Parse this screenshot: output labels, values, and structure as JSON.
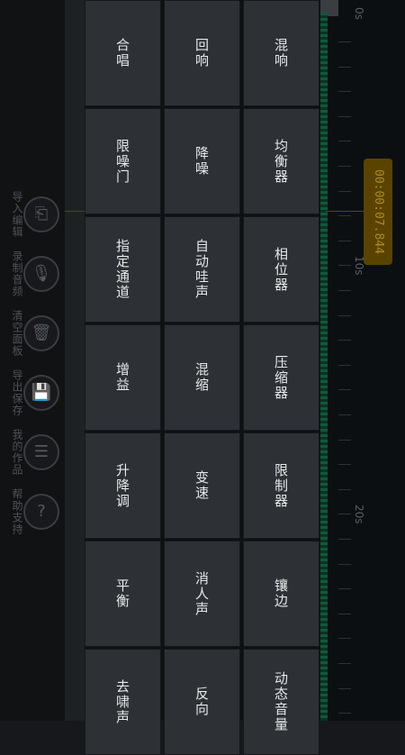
{
  "toolbar": {
    "tools": [
      {
        "label": "导入编辑",
        "icon": "import-icon",
        "glyph": "⎗"
      },
      {
        "label": "录制音频",
        "icon": "microphone-icon",
        "glyph": "🎙"
      },
      {
        "label": "清空面板",
        "icon": "trash-icon",
        "glyph": "🗑"
      },
      {
        "label": "导出保存",
        "icon": "save-icon",
        "glyph": "💾"
      },
      {
        "label": "我的作品",
        "icon": "list-icon",
        "glyph": "☰"
      },
      {
        "label": "帮助支持",
        "icon": "help-icon",
        "glyph": "?"
      }
    ]
  },
  "timeline": {
    "labels": [
      "0s",
      "10s",
      "20s"
    ],
    "timecode": "00:00:07.844"
  },
  "effects_menu": {
    "columns": [
      [
        "混响",
        "均衡器",
        "相位器",
        "压缩器",
        "限制器",
        "镶边",
        "动态音量"
      ],
      [
        "回响",
        "降噪",
        "自动哇声",
        "混缩",
        "变速",
        "消人声",
        "反向"
      ],
      [
        "合唱",
        "限噪门",
        "指定通道",
        "增益",
        "升降调",
        "平衡",
        "去啸声"
      ]
    ]
  },
  "colors": {
    "accent": "#ab8b1e",
    "cell_bg": "#2d3136",
    "wave": "#0f5a3a"
  }
}
